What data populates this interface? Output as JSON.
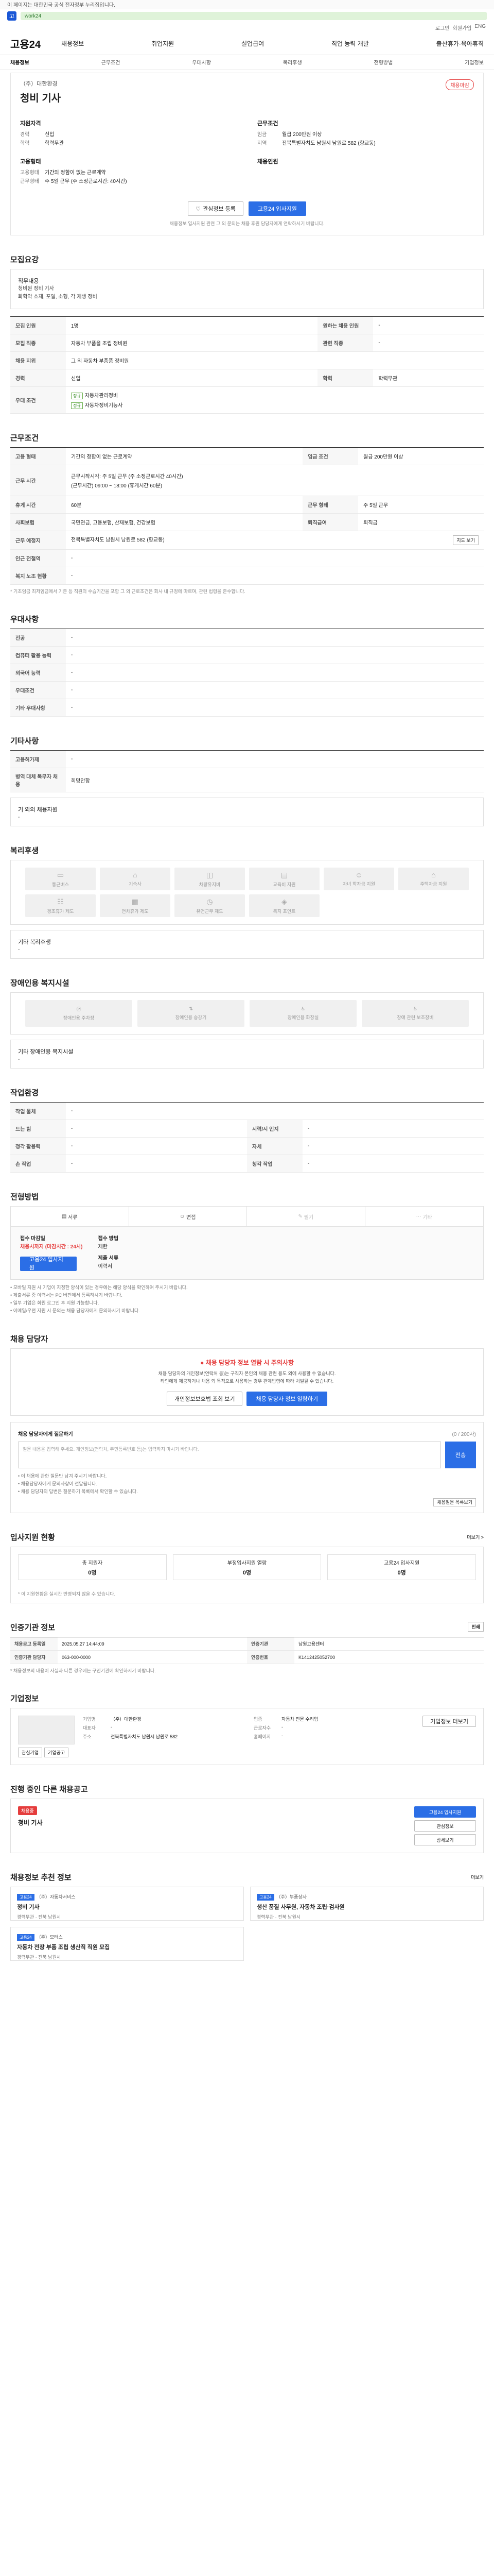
{
  "browser": {
    "notice": "이 페이지는 대한민국 공식 전자정부 누리집입니다.",
    "logo_glyph": "고",
    "address": "work24"
  },
  "util_links": [
    "로그인",
    "회원가입",
    "ENG"
  ],
  "header": {
    "brand": "고용24",
    "gnb": [
      "채용정보",
      "취업지원",
      "실업급여",
      "직업 능력 개발",
      "출산휴가·육아휴직"
    ],
    "subnav": [
      "채용정보",
      "근무조건",
      "우대사항",
      "복리후생",
      "전형방법",
      "기업정보"
    ]
  },
  "job": {
    "company": "（주）대한환경",
    "title": "청비 기사",
    "badge": "채용마감",
    "summary_left_title": "지원자격",
    "summary_left": [
      {
        "k": "경력",
        "v": "신입"
      },
      {
        "k": "학력",
        "v": "학력무관"
      }
    ],
    "summary_right_title": "근무조건",
    "summary_right": [
      {
        "k": "임금",
        "v": "월급 200만원 이상"
      },
      {
        "k": "지역",
        "v": "전북특별자치도 남원시 남원로 582 (향교동)"
      }
    ],
    "summary_left2_title": "고용형태",
    "summary_left2": [
      {
        "k": "고용형태",
        "v": "기간의 정함이 없는 근로계약"
      },
      {
        "k": "근무형태",
        "v": "주 5일 근무 (주 소정근로시간: 40시간)"
      }
    ],
    "summary_right2_title": "채용인원",
    "summary_right2": [],
    "btn_scrap": "관심정보 등록",
    "btn_apply": "고용24 입사지원",
    "notice": "채용정보 입사지원 관련 그 외 문의는 채용 후원 담당자에게 연락하시기 바랍니다."
  },
  "desc": {
    "title": "모집요강",
    "head": "직무내용",
    "lines": [
      "청비원 정비 기사",
      "화학약 소재, 포일, 소형, 각 재생 정비"
    ]
  },
  "recruit_table": [
    {
      "k": "모집 인원",
      "v": "1명",
      "k2": "원하는 채용 인원",
      "v2": "-"
    },
    {
      "k": "모집 직종",
      "v": "자동차 부품을 조립 정비원",
      "k2": "관련 직종",
      "v2": "-"
    },
    {
      "k": "채용 지위",
      "v": "그 외 자동차 부품품 정비원",
      "k2": "",
      "v2": ""
    },
    {
      "k": "경력",
      "v": "신입",
      "k2": "학력",
      "v2": "학력무관"
    }
  ],
  "extra": {
    "label": "우대 조건",
    "tag1": "정규",
    "v1": "자동차관리정비",
    "tag2": "정규",
    "v2": "자동차정비기능사"
  },
  "cond": {
    "title": "근무조건",
    "rows": [
      {
        "k": "고용 형태",
        "v": "기간의 정함이 없는 근로계약",
        "k2": "임금 조건",
        "v2": "월급 200만원 이상"
      },
      {
        "k": "근무 시간",
        "v": "근무시작시각: 주 5일 근무 (주 소정근로시간 40시간)",
        "k2": "",
        "v2": ""
      },
      {
        "k": "",
        "v": "(근무시간) 09:00 ~ 18:00 (휴게시간 60분)",
        "k2": "",
        "v2": ""
      },
      {
        "k": "휴게 시간",
        "v": "60분",
        "k2": "근무 형태",
        "v2": "주 5일 근무"
      },
      {
        "k": "사회보험",
        "v": "국민연금, 고용보험, 산재보험, 건강보험",
        "k2": "퇴직급여",
        "v2": "퇴직금"
      },
      {
        "k": "근무 예정지",
        "v": "전북특별자치도 남원시 남원로 582 (향교동)",
        "k2": "",
        "v2": ""
      },
      {
        "k": "인근 전철역",
        "v": "-",
        "k2": "",
        "v2": ""
      },
      {
        "k": "복지 노조 현황",
        "v": "-",
        "k2": "",
        "v2": ""
      }
    ],
    "map_btn": "지도 보기",
    "note": "* 기초임금 최저임금에서 기준 등 직원의 수습기간을 포함 그 외 근로조건은 회사 내 규정에 따르며, 관련 법령을 준수합니다."
  },
  "pref": {
    "title": "우대사항",
    "rows": [
      {
        "k": "전공",
        "v": "-"
      },
      {
        "k": "컴퓨터 활용 능력",
        "v": "-"
      },
      {
        "k": "외국어 능력",
        "v": "-"
      },
      {
        "k": "우대조건",
        "v": "-"
      },
      {
        "k": "기타 우대사항",
        "v": "-"
      }
    ]
  },
  "other": {
    "title": "기타사항",
    "rows": [
      {
        "k": "고용허가제",
        "v": "-"
      },
      {
        "k": "병역 대체 복무자 채용",
        "v": "희망안함"
      }
    ],
    "box_label": "기 외의 채용자원",
    "box_value": "-"
  },
  "welfare": {
    "title": "복리후생",
    "items": [
      "통근버스",
      "기숙사",
      "차량유지비",
      "교육비 지원",
      "자녀 학자금 지원",
      "주택자금 지원",
      "경조휴가 제도",
      "연차휴가 제도",
      "유연근무 제도",
      "복지 포인트"
    ],
    "box_label": "기타 복리후생",
    "box_value": "-"
  },
  "disabled": {
    "title": "장애인용 복지시설",
    "items": [
      "장애인용 주차장",
      "장애인용 승강기",
      "장애인용 화장실",
      "장애 관련 보조장비"
    ],
    "box_label": "기타 장애인용 복지시설",
    "box_value": "-"
  },
  "env": {
    "title": "작업환경",
    "rows": [
      {
        "k": "작업 물체",
        "v": "-",
        "k2": "",
        "v2": ""
      },
      {
        "k": "드는 힘",
        "v": "-",
        "k2": "시력/시 인지",
        "v2": "-"
      },
      {
        "k": "청각 활용력",
        "v": "-",
        "k2": "자세",
        "v2": "-"
      },
      {
        "k": "손 작업",
        "v": "-",
        "k2": "청각 작업",
        "v2": "-"
      }
    ]
  },
  "method": {
    "title": "전형방법",
    "steps": [
      "서류",
      "면접",
      "필기",
      "기타"
    ],
    "apply_title": "접수 마감일",
    "apply_value": "채용시까지 (마감시간 : 24시)",
    "apply_method_title": "접수 방법",
    "apply_method_value": "제한",
    "doc_title": "제출 서류",
    "doc_value": "이력서",
    "apply_btn": "고용24 입사지원",
    "bullets": [
      "• 모바일 지원 시 기업이 지정한 양식이 있는 경우에는 해당 양식을 확인하여 주시기 바랍니다.",
      "• 제출서류 중 이력서는 PC 버전에서 등록하시기 바랍니다.",
      "• 일부 기업은 회원 로그인 후 지원 가능합니다.",
      "• 이메일/우편 지원 시 문의는 채용 담당자에게 문의하시기 바랍니다."
    ]
  },
  "chat": {
    "title": "채용 담당자",
    "warn": "채용 담당자 정보 열람 시 주의사항",
    "sub1": "채용 담당자의 개인정보(연락처 등)는 구직자 본인의 채용 관련 용도 외에 사용할 수 없습니다.",
    "sub2": "타인에게 제공하거나 채용 외 목적으로 사용하는 경우 관계법령에 따라 처벌될 수 있습니다.",
    "btn1": "개인정보보호법 조회 보기",
    "btn2": "채용 담당자 정보 열람하기",
    "q_title": "채용 담당자에게 질문하기",
    "q_limit": "(0 / 200자)",
    "q_placeholder": "질문 내용을 입력해 주세요. 개인정보(연락처, 주민등록번호 등)는 입력하지 마시기 바랍니다.",
    "q_btn": "전송",
    "q_notes": [
      "• 이 채용에 관한 질문만 남겨 주시기 바랍니다.",
      "• 채용담당자에게 문의사항이 전달됩니다.",
      "• 채용 담당자의 답변은 질문하기 목록에서 확인할 수 있습니다."
    ],
    "q_list_btn": "채용질문 목록보기"
  },
  "status": {
    "title": "입사지원 현황",
    "more": "더보기 >",
    "items": [
      {
        "label": "총 지원자",
        "value": "0명"
      },
      {
        "label": "부정입사지원 열람",
        "value": "0명"
      },
      {
        "label": "고용24 입사지원",
        "value": "0명"
      }
    ],
    "note": "* 이 지원현황은 실시간 반영되지 않을 수 있습니다."
  },
  "basic": {
    "title": "인증기관 정보",
    "print_btn": "인쇄",
    "rows": [
      {
        "k": "채용공고 등록일",
        "v": "2025.05.27 14:44:09",
        "k2": "인증기관",
        "v2": "남원고용센터"
      },
      {
        "k": "인증기관 담당자",
        "v": "063-000-0000",
        "k2": "인증번호",
        "v2": "K1412425052700"
      }
    ],
    "note": "* 채용정보의 내용이 사실과 다른 경우에는 구인기관에 확인하시기 바랍니다."
  },
  "company": {
    "title": "기업정보",
    "btn": "기업정보 더보기",
    "fields": [
      {
        "k": "기업명",
        "v": "（주）대한환경"
      },
      {
        "k": "업종",
        "v": "자동차 전문 수리업"
      },
      {
        "k": "대표자",
        "v": "-"
      },
      {
        "k": "근로자수",
        "v": "-"
      },
      {
        "k": "주소",
        "v": "전북특별자치도 남원시 남원로 582"
      },
      {
        "k": "홈페이지",
        "v": "-"
      }
    ],
    "small_btn1": "관심기업",
    "small_btn2": "기업공고"
  },
  "ongoing": {
    "title": "진행 중인 다른 채용공고",
    "pill": "채용중",
    "job_title": "청비 기사",
    "btn1": "고용24 입사지원",
    "btn2": "관심정보",
    "btn3": "상세보기"
  },
  "recommend": {
    "title": "채용정보 추천 정보",
    "more": "더보기",
    "jobs": [
      {
        "pill": "고용24",
        "co": "（주）자동차서비스",
        "title": "정비 기사",
        "meta": "경력무관 · 전북 남원시"
      },
      {
        "pill": "고용24",
        "co": "（주）부품상사",
        "title": "생산 품질 사무원, 자동차 조립·검사원",
        "meta": "경력무관 · 전북 남원시"
      },
      {
        "pill": "고용24",
        "co": "（주）모터스",
        "title": "자동차 전장 부품 조립 생산직 직원 모집",
        "meta": "경력무관 · 전북 남원시"
      }
    ]
  }
}
